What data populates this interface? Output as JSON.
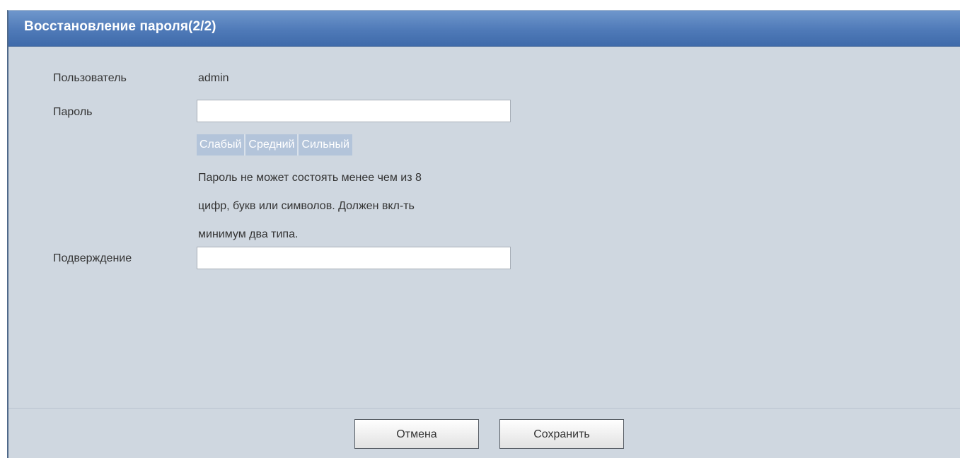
{
  "dialog": {
    "title": "Восстановление пароля(2/2)"
  },
  "form": {
    "user_label": "Пользователь",
    "user_value": "admin",
    "password_label": "Пароль",
    "password_value": "",
    "strength_levels": [
      "Слабый",
      "Средний",
      "Сильный"
    ],
    "hint_lines": [
      "Пароль не может состоять менее чем из 8",
      "цифр, букв или символов. Должен вкл-ть",
      "минимум два типа."
    ],
    "confirm_label": "Подверждение",
    "confirm_value": ""
  },
  "footer": {
    "cancel_label": "Отмена",
    "save_label": "Сохранить"
  },
  "colors": {
    "titlebar": "#4f7ab8",
    "panel_bg": "#cfd7e0",
    "strength_bg": "#b3c4da"
  }
}
